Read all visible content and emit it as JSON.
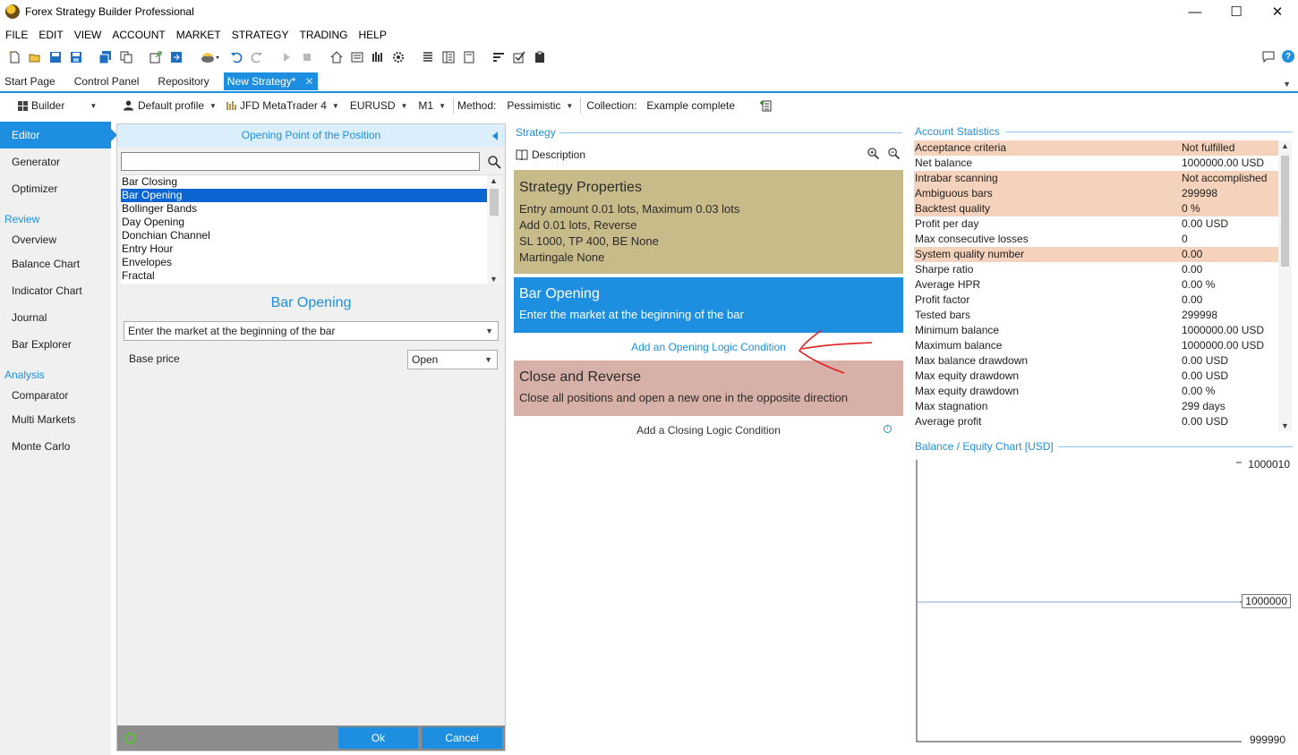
{
  "window": {
    "title": "Forex Strategy Builder Professional",
    "minimize": "—",
    "maximize": "☐",
    "close": "✕"
  },
  "menu": [
    "FILE",
    "EDIT",
    "VIEW",
    "ACCOUNT",
    "MARKET",
    "STRATEGY",
    "TRADING",
    "HELP"
  ],
  "toolbar_icons": [
    "new-strategy-icon",
    "open-icon",
    "save-icon",
    "save-as-icon",
    "save-all-icon",
    "copy-icon",
    "export-icon",
    "import-icon",
    "broker-icon",
    "undo-icon",
    "redo-icon",
    "play-icon",
    "stop-icon",
    "home-icon",
    "report-icon",
    "chart-icon",
    "settings-icon",
    "list-icon",
    "journal-icon",
    "document-icon",
    "sort-icon",
    "check-icon",
    "clipboard-icon"
  ],
  "tabs": [
    {
      "label": "Start Page"
    },
    {
      "label": "Control Panel"
    },
    {
      "label": "Repository"
    },
    {
      "label": "New Strategy*",
      "close": "✕"
    }
  ],
  "strategy_bar": {
    "mode": "Builder",
    "profile": "Default profile",
    "broker": "JFD MetaTrader 4",
    "symbol": "EURUSD",
    "period": "M1",
    "method_label": "Method:",
    "method": "Pessimistic",
    "collection_label": "Collection:",
    "collection": "Example complete"
  },
  "nav": {
    "editor": "Editor",
    "generator": "Generator",
    "optimizer": "Optimizer",
    "review_heading": "Review",
    "overview": "Overview",
    "balance_chart": "Balance Chart",
    "indicator_chart": "Indicator Chart",
    "journal": "Journal",
    "bar_explorer": "Bar Explorer",
    "analysis_heading": "Analysis",
    "comparator": "Comparator",
    "multi_markets": "Multi Markets",
    "monte_carlo": "Monte Carlo"
  },
  "opening_panel": {
    "header": "Opening Point of the Position",
    "search_value": "",
    "indicators": [
      "Bar Closing",
      "Bar Opening",
      "Bollinger Bands",
      "Day Opening",
      "Donchian Channel",
      "Entry Hour",
      "Envelopes",
      "Fractal"
    ],
    "selected_indicator": "Bar Opening",
    "slot_title": "Bar Opening",
    "logic": "Enter the market at the beginning of the bar",
    "param_label": "Base price",
    "param_value": "Open",
    "ok": "Ok",
    "cancel": "Cancel"
  },
  "strategy": {
    "section": "Strategy",
    "description": "Description",
    "properties": {
      "title": "Strategy Properties",
      "lines": [
        "Entry amount 0.01 lots, Maximum 0.03 lots",
        "Add 0.01 lots, Reverse",
        "SL 1000,  TP 400,  BE None",
        "Martingale None"
      ]
    },
    "opening": {
      "title": "Bar Opening",
      "desc": "Enter the market at the beginning of the bar"
    },
    "add_opening": "Add an Opening Logic Condition",
    "closing": {
      "title": "Close and Reverse",
      "desc": "Close all positions and open a new one in the opposite direction"
    },
    "add_closing": "Add a Closing Logic Condition",
    "colors": {
      "properties": "#c8bb8a",
      "opening": "#1e8fe0",
      "closing": "#d7b0a8"
    }
  },
  "account_stats": {
    "section": "Account Statistics",
    "rows": [
      {
        "k": "Acceptance criteria",
        "v": "Not fulfilled",
        "hl": true
      },
      {
        "k": "Net balance",
        "v": "1000000.00 USD",
        "hl": false
      },
      {
        "k": "Intrabar scanning",
        "v": "Not accomplished",
        "hl": true
      },
      {
        "k": "Ambiguous bars",
        "v": "299998",
        "hl": true
      },
      {
        "k": "Backtest quality",
        "v": "0 %",
        "hl": true
      },
      {
        "k": "Profit per day",
        "v": "0.00 USD",
        "hl": false
      },
      {
        "k": "Max consecutive losses",
        "v": "0",
        "hl": false
      },
      {
        "k": "System quality number",
        "v": "0.00",
        "hl": true
      },
      {
        "k": "Sharpe ratio",
        "v": "0.00",
        "hl": false
      },
      {
        "k": "Average HPR",
        "v": "0.00 %",
        "hl": false
      },
      {
        "k": "Profit factor",
        "v": "0.00",
        "hl": false
      },
      {
        "k": "Tested bars",
        "v": "299998",
        "hl": false
      },
      {
        "k": "Minimum balance",
        "v": "1000000.00 USD",
        "hl": false
      },
      {
        "k": "Maximum balance",
        "v": "1000000.00 USD",
        "hl": false
      },
      {
        "k": "Max balance drawdown",
        "v": "0.00 USD",
        "hl": false
      },
      {
        "k": "Max equity drawdown",
        "v": "0.00 USD",
        "hl": false
      },
      {
        "k": "Max equity drawdown",
        "v": "0.00 %",
        "hl": false
      },
      {
        "k": "Max stagnation",
        "v": "299 days",
        "hl": false
      },
      {
        "k": "Average profit",
        "v": "0.00 USD",
        "hl": false
      }
    ]
  },
  "chart_data": {
    "type": "line",
    "title": "Balance / Equity Chart [USD]",
    "ylim": [
      999990,
      1000010
    ],
    "yticks": [
      "1000010",
      "1000000",
      "999990"
    ],
    "series": [
      {
        "values": [
          1000000,
          1000000
        ]
      }
    ],
    "grid": false,
    "line_color": "#8aa6d8"
  }
}
